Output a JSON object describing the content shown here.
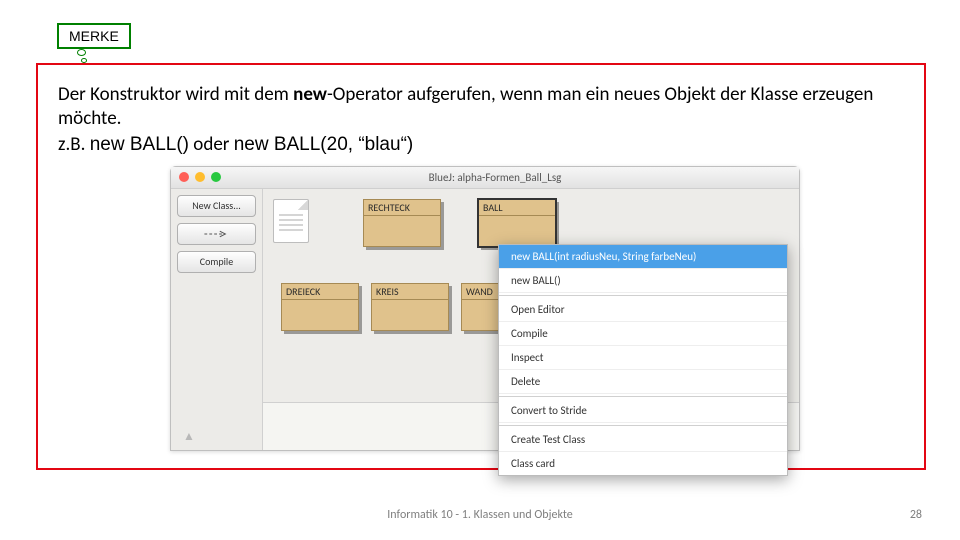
{
  "badge": {
    "label": "MERKE"
  },
  "paragraph": {
    "prefix": "Der Konstruktor wird mit dem ",
    "bold": "new",
    "suffix": "-Operator aufgerufen, wenn man ein neues Objekt der Klasse erzeugen möchte."
  },
  "example": {
    "prefix": "z.B. ",
    "code1": "new BALL()",
    "mid": " oder ",
    "code2": "new BALL(20, “blau“)"
  },
  "bluej": {
    "title": "BlueJ:  alpha-Formen_Ball_Lsg",
    "buttons": {
      "newClass": "New Class...",
      "compile": "Compile"
    },
    "classes": {
      "rechteck": "RECHTECK",
      "ball": "BALL",
      "dreieck": "DREIECK",
      "kreis": "KREIS",
      "wand": "WAND"
    },
    "contextMenu": [
      "new BALL(int radiusNeu, String farbeNeu)",
      "new BALL()",
      "Open Editor",
      "Compile",
      "Inspect",
      "Delete",
      "Convert to Stride",
      "Create Test Class",
      "Class card"
    ]
  },
  "footer": {
    "center": "Informatik 10 - 1. Klassen und Objekte",
    "page": "28"
  }
}
